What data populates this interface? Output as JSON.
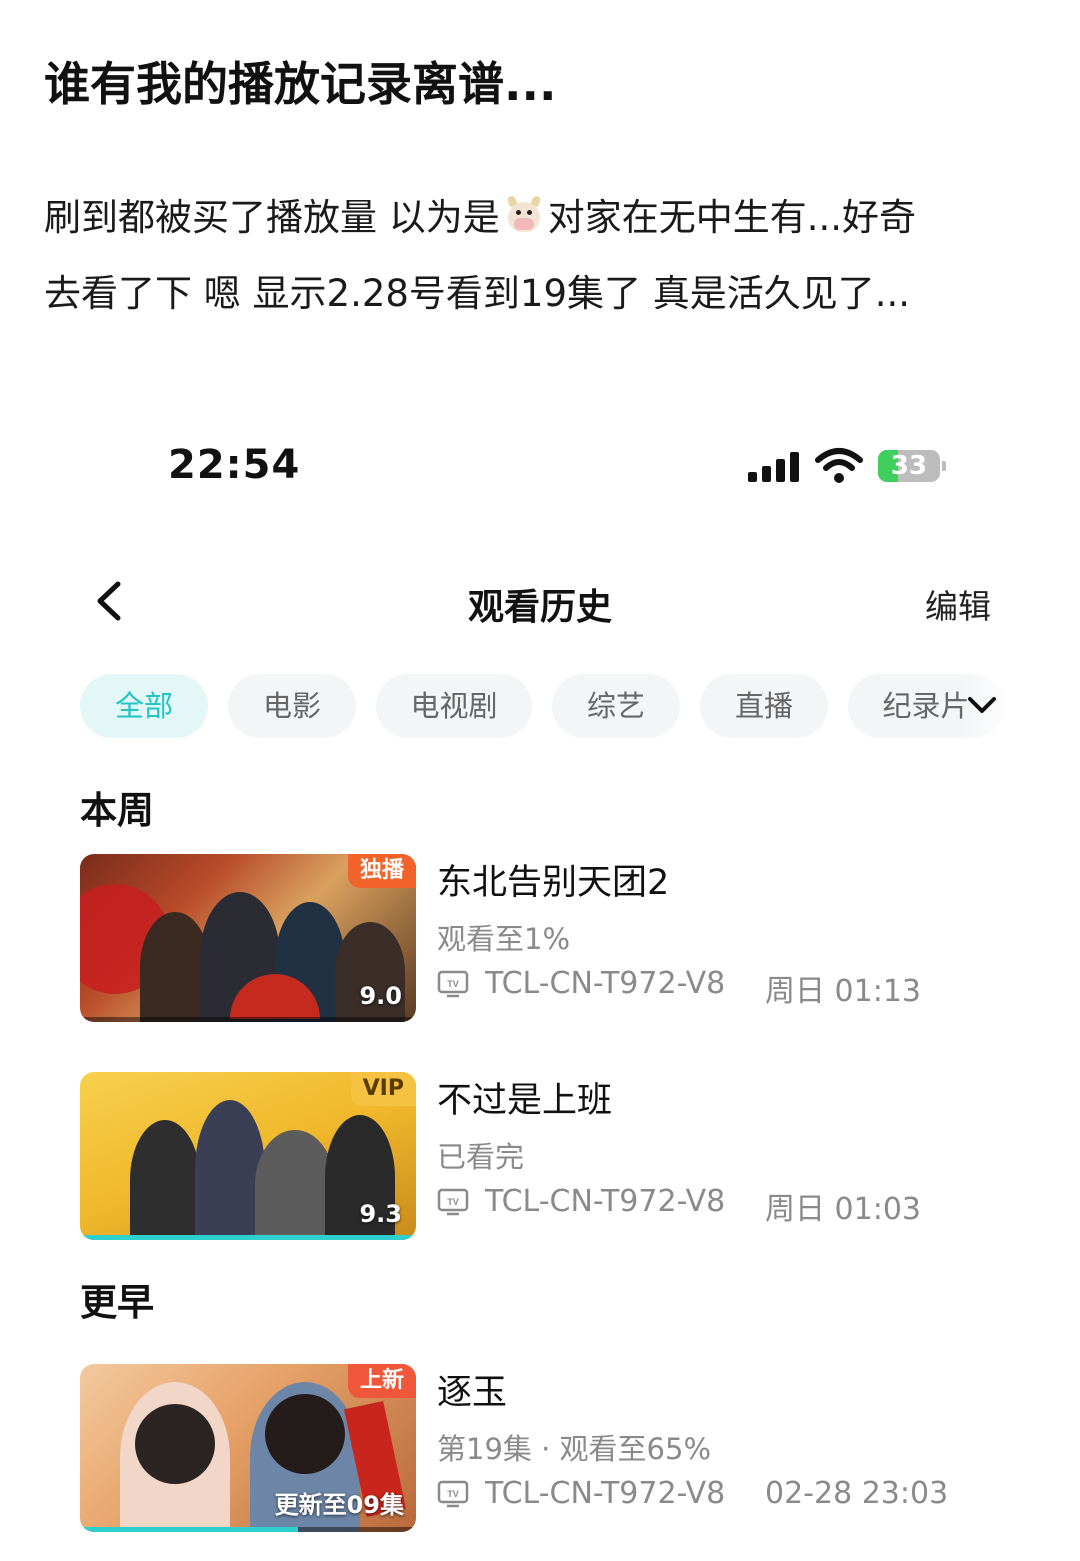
{
  "post": {
    "title": "谁有我的播放记录离谱...",
    "body_line1_before": "刷到都被买了播放量 以为是",
    "body_line1_after": "对家在无中生有...好奇",
    "body_line2": "去看了下 嗯 显示2.28号看到19集了 真是活久见了..."
  },
  "status_bar": {
    "time": "22:54",
    "battery": "33",
    "battery_level": 0.33
  },
  "nav": {
    "title": "观看历史",
    "edit_label": "编辑"
  },
  "tabs": [
    {
      "label": "全部",
      "active": true
    },
    {
      "label": "电影"
    },
    {
      "label": "电视剧"
    },
    {
      "label": "综艺"
    },
    {
      "label": "直播"
    },
    {
      "label": "纪录片"
    }
  ],
  "sections": [
    {
      "heading": "本周",
      "items": [
        {
          "title": "东北告别天团2",
          "status": "观看至1%",
          "device": "TCL-CN-T972-V8",
          "time": "周日 01:13",
          "badge": "独播",
          "score": "9.0",
          "progress": 0.01
        },
        {
          "title": "不过是上班",
          "status": "已看完",
          "device": "TCL-CN-T972-V8",
          "time": "周日 01:03",
          "badge": "VIP",
          "score": "9.3",
          "progress": 1.0
        }
      ]
    },
    {
      "heading": "更早",
      "items": [
        {
          "title": "逐玉",
          "status": "第19集 · 观看至65%",
          "device": "TCL-CN-T972-V8",
          "time": "02-28 23:03",
          "badge": "上新",
          "update": "更新至09集",
          "progress": 0.65
        }
      ]
    }
  ],
  "colors": {
    "accent": "#22c4c4",
    "progress": "#2dd0cf",
    "badge_exclusive": "#f2632b",
    "badge_vip": "#f5c242",
    "badge_new": "#f0563a"
  }
}
